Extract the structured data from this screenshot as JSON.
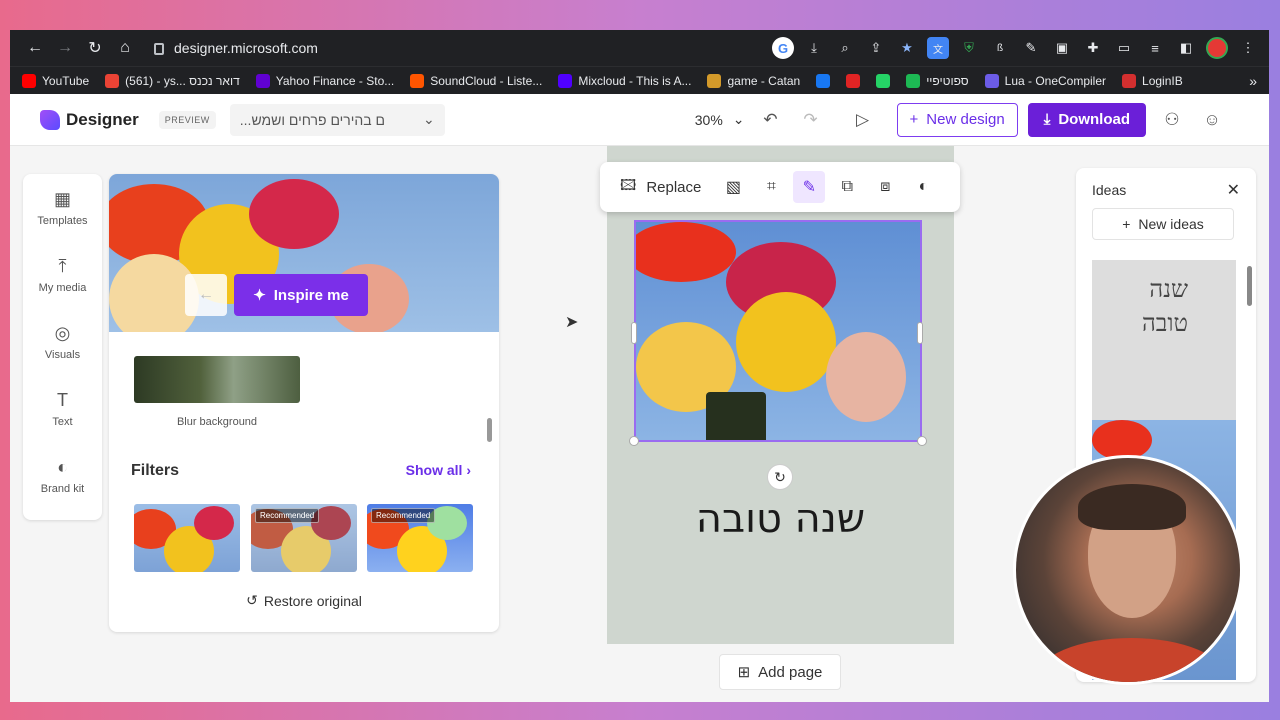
{
  "browser": {
    "url": "designer.microsoft.com",
    "bookmarks": [
      {
        "label": "YouTube",
        "color": "#ff0000"
      },
      {
        "label": "(561) - ys... דואר נכנס",
        "color": "#ea4335"
      },
      {
        "label": "Yahoo Finance - Sto...",
        "color": "#6001d2"
      },
      {
        "label": "SoundCloud - Liste...",
        "color": "#ff5500"
      },
      {
        "label": "Mixcloud - This is A...",
        "color": "#5000ff"
      },
      {
        "label": "game - Catan",
        "color": "#d49a2a"
      },
      {
        "label": "",
        "color": "#1877f2"
      },
      {
        "label": "",
        "color": "#e02424"
      },
      {
        "label": "",
        "color": "#25d366"
      },
      {
        "label": "ספוטיפיי",
        "color": "#1db954"
      },
      {
        "label": "Lua - OneCompiler",
        "color": "#6c5ce7"
      },
      {
        "label": "LoginIB",
        "color": "#d32f2f"
      }
    ],
    "more": "»"
  },
  "header": {
    "app_name": "Designer",
    "preview": "PREVIEW",
    "doc_title": "...ם בהירים פרחים ושמש",
    "zoom": "30%",
    "new_design": "New design",
    "download": "Download",
    "accent": "#6b1fd8"
  },
  "rail": [
    {
      "label": "Templates",
      "icon": "▦"
    },
    {
      "label": "My media",
      "icon": "⤒"
    },
    {
      "label": "Visuals",
      "icon": "◎"
    },
    {
      "label": "Text",
      "icon": "T"
    },
    {
      "label": "Brand kit",
      "icon": "◐"
    }
  ],
  "panel": {
    "inspire": "Inspire me",
    "blur_label": "Blur background",
    "filters_title": "Filters",
    "show_all": "Show all",
    "recommended": "Recommended",
    "restore": "Restore original"
  },
  "toolbar": {
    "replace": "Replace"
  },
  "canvas": {
    "text": "שנה טובה",
    "add_page": "Add page"
  },
  "ideas": {
    "title": "Ideas",
    "new_ideas": "New ideas",
    "card_line1": "שנה",
    "card_line2": "טובה"
  }
}
